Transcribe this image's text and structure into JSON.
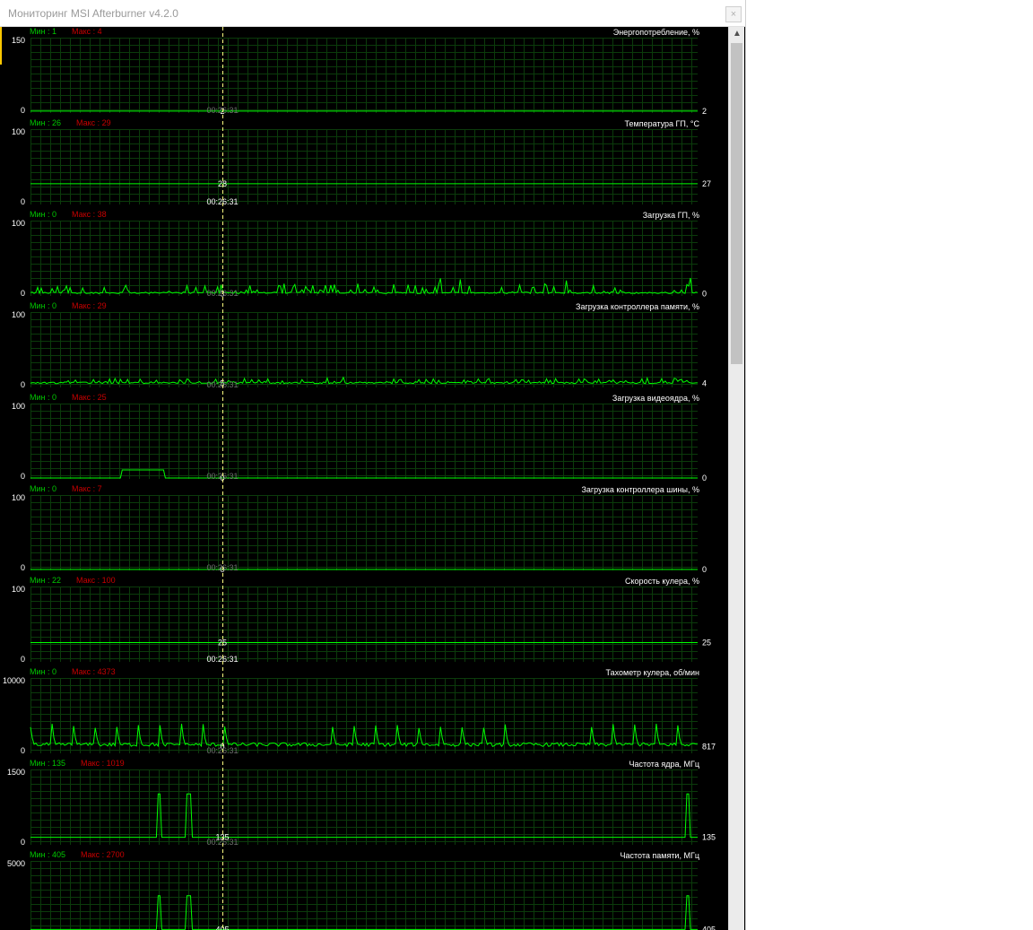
{
  "window": {
    "title": "Мониторинг MSI Afterburner v4.2.0",
    "close_label": "×"
  },
  "scrollbar": {
    "up_arrow": "▲"
  },
  "colors": {
    "background": "#000000",
    "grid": "#0b3b0b",
    "line": "#00ff00",
    "min_label": "#00c800",
    "max_label": "#c80000",
    "axis_text": "#ffffff",
    "cursor": "#ffff80"
  },
  "cursor_time": "00:26:31",
  "min_prefix": "Мин : ",
  "max_prefix": "Макс : ",
  "graphs": [
    {
      "title": "Энергопотребление, %",
      "min": "1",
      "max": "4",
      "y_max": "150",
      "y_min": "0",
      "current": "2",
      "cursor_value": "2",
      "range": 150,
      "kind": "flat",
      "level": 2
    },
    {
      "title": "Температура ГП, °С",
      "min": "26",
      "max": "29",
      "y_max": "100",
      "y_min": "0",
      "current": "27",
      "cursor_value": "28",
      "range": 100,
      "kind": "flat",
      "level": 27
    },
    {
      "title": "Загрузка ГП, %",
      "min": "0",
      "max": "38",
      "y_max": "100",
      "y_min": "0",
      "current": "0",
      "cursor_value": "3",
      "range": 100,
      "kind": "spiky",
      "level": 2,
      "amp": 12
    },
    {
      "title": "Загрузка контроллера памяти, %",
      "min": "0",
      "max": "29",
      "y_max": "100",
      "y_min": "0",
      "current": "4",
      "cursor_value": "5",
      "range": 100,
      "kind": "spiky",
      "level": 4,
      "amp": 6
    },
    {
      "title": "Загрузка видеоядра, %",
      "min": "0",
      "max": "25",
      "y_max": "100",
      "y_min": "0",
      "current": "0",
      "cursor_value": "0",
      "range": 100,
      "kind": "bump",
      "level": 0,
      "bump_level": 11
    },
    {
      "title": "Загрузка контроллера шины, %",
      "min": "0",
      "max": "7",
      "y_max": "100",
      "y_min": "0",
      "current": "0",
      "cursor_value": "0",
      "range": 100,
      "kind": "flat",
      "level": 0
    },
    {
      "title": "Скорость кулера, %",
      "min": "22",
      "max": "100",
      "y_max": "100",
      "y_min": "0",
      "current": "25",
      "cursor_value": "25",
      "range": 100,
      "kind": "flat",
      "level": 25
    },
    {
      "title": "Тахометр кулера, об/мин",
      "min": "0",
      "max": "4373",
      "y_max": "10000",
      "y_min": "0",
      "current": "817",
      "cursor_value": "0",
      "range": 10000,
      "kind": "tach",
      "level": 817,
      "peak": 4373
    },
    {
      "title": "Частота ядра, МГц",
      "min": "135",
      "max": "1019",
      "y_max": "1500",
      "y_min": "0",
      "current": "135",
      "cursor_value": "135",
      "range": 1500,
      "kind": "clock",
      "level": 135,
      "peak": 1019
    },
    {
      "title": "Частота памяти, МГц",
      "min": "405",
      "max": "2700",
      "y_max": "5000",
      "y_min": "0",
      "current": "405",
      "cursor_value": "405",
      "range": 5000,
      "kind": "clock",
      "level": 405,
      "peak": 2700
    }
  ]
}
